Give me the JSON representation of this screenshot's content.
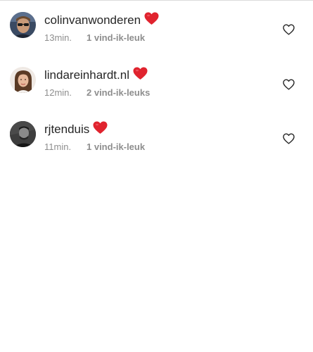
{
  "comments": [
    {
      "username": "colinvanwonderen",
      "emoji": "heart-emoji",
      "time": "13min.",
      "likes": "1 vind-ik-leuk",
      "like_icon": "heart-outline-icon"
    },
    {
      "username": "lindareinhardt.nl",
      "emoji": "heart-emoji",
      "time": "12min.",
      "likes": "2 vind-ik-leuks",
      "like_icon": "heart-outline-icon"
    },
    {
      "username": "rjtenduis",
      "emoji": "heart-emoji",
      "time": "11min.",
      "likes": "1 vind-ik-leuk",
      "like_icon": "heart-outline-icon"
    }
  ],
  "colors": {
    "text": "#262626",
    "meta": "#8e8e8e",
    "heart_red": "#e0232e",
    "divider": "#dbdbdb"
  }
}
